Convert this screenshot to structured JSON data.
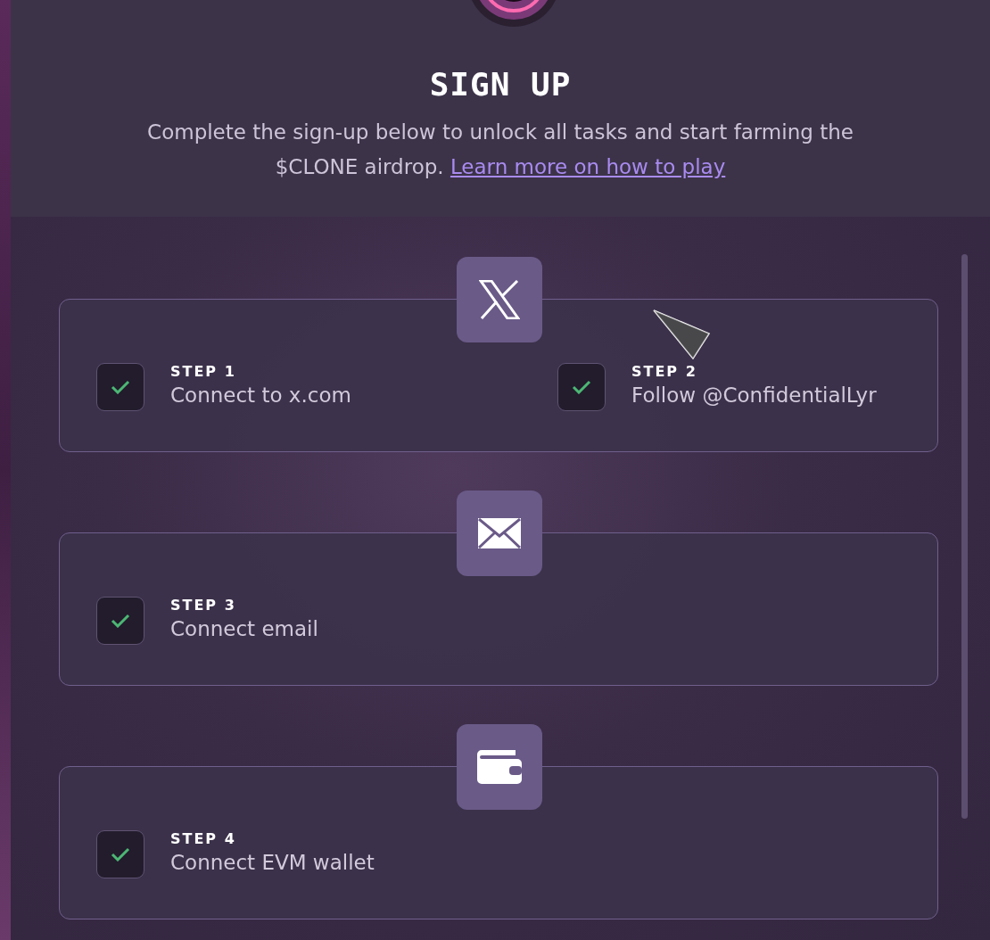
{
  "header": {
    "title": "SIGN UP",
    "description": "Complete the sign-up below to unlock all tasks and start farming the $CLONE airdrop.",
    "link": "Learn more on how to play"
  },
  "sections": [
    {
      "kind": "x",
      "steps": [
        {
          "label": "STEP 1",
          "title": "Connect to x.com",
          "checked": true
        },
        {
          "label": "STEP 2",
          "title": "Follow @ConfidentialLyr",
          "checked": true
        }
      ]
    },
    {
      "kind": "email",
      "steps": [
        {
          "label": "STEP 3",
          "title": "Connect email",
          "checked": true
        }
      ]
    },
    {
      "kind": "wallet",
      "steps": [
        {
          "label": "STEP 4",
          "title": "Connect EVM wallet",
          "checked": true
        }
      ]
    }
  ]
}
